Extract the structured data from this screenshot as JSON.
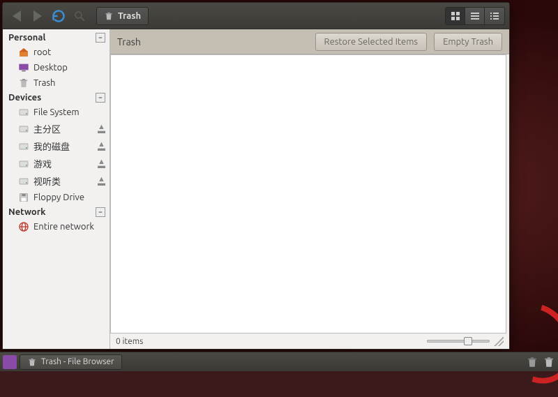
{
  "window": {
    "location_label": "Trash",
    "breadcrumb": "Trash",
    "restore_btn": "Restore Selected Items",
    "empty_btn": "Empty Trash",
    "status_text": "0 items"
  },
  "sidebar": {
    "sections": [
      {
        "title": "Personal",
        "items": [
          {
            "label": "root",
            "icon": "home"
          },
          {
            "label": "Desktop",
            "icon": "desktop"
          },
          {
            "label": "Trash",
            "icon": "trash"
          }
        ]
      },
      {
        "title": "Devices",
        "items": [
          {
            "label": "File System",
            "icon": "drive"
          },
          {
            "label": "主分区",
            "icon": "drive",
            "ejectable": true
          },
          {
            "label": "我的磁盘",
            "icon": "drive",
            "ejectable": true
          },
          {
            "label": "游戏",
            "icon": "drive",
            "ejectable": true
          },
          {
            "label": "视听类",
            "icon": "drive",
            "ejectable": true
          },
          {
            "label": "Floppy Drive",
            "icon": "floppy"
          }
        ]
      },
      {
        "title": "Network",
        "items": [
          {
            "label": "Entire network",
            "icon": "network"
          }
        ]
      }
    ]
  },
  "taskbar": {
    "active_task": "Trash - File Browser"
  }
}
